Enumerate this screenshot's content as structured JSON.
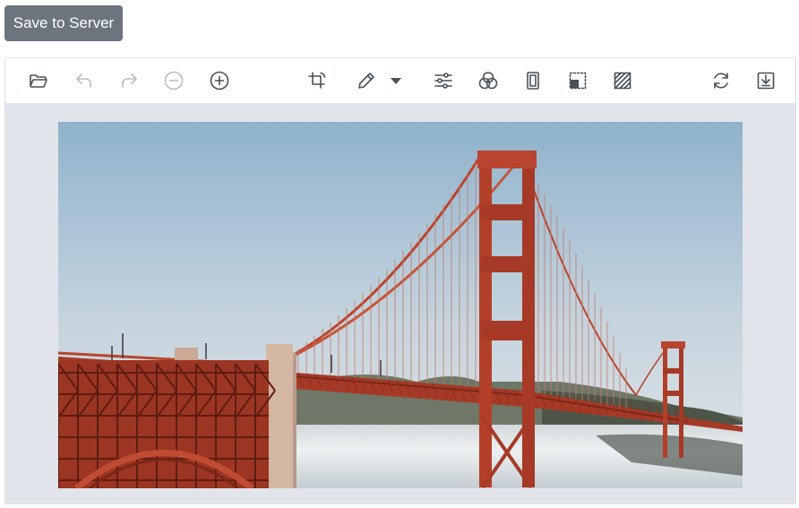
{
  "save_button": {
    "label": "Save to Server"
  },
  "toolbar": {
    "items": [
      {
        "name": "open-icon",
        "enabled": true
      },
      {
        "name": "undo-icon",
        "enabled": false
      },
      {
        "name": "redo-icon",
        "enabled": false
      },
      {
        "name": "zoom-out-icon",
        "enabled": false
      },
      {
        "name": "zoom-in-icon",
        "enabled": true
      },
      {
        "name": "crop-transform-icon",
        "enabled": true
      },
      {
        "name": "annotate-pen-icon",
        "enabled": true
      },
      {
        "name": "annotate-dropdown-icon",
        "enabled": true
      },
      {
        "name": "finetune-sliders-icon",
        "enabled": true
      },
      {
        "name": "filters-icon",
        "enabled": true
      },
      {
        "name": "frame-icon",
        "enabled": true
      },
      {
        "name": "redact-icon",
        "enabled": true
      },
      {
        "name": "texture-icon",
        "enabled": true
      },
      {
        "name": "reset-icon",
        "enabled": true
      },
      {
        "name": "save-download-icon",
        "enabled": true
      }
    ]
  },
  "canvas": {
    "image_subject": "golden-gate-bridge-photo",
    "colors": {
      "sky_top": "#8fb2cc",
      "sky_bottom": "#d8e0e6",
      "bridge": "#b9442c",
      "fog": "#e9ecee",
      "hills": "#55604f"
    }
  }
}
